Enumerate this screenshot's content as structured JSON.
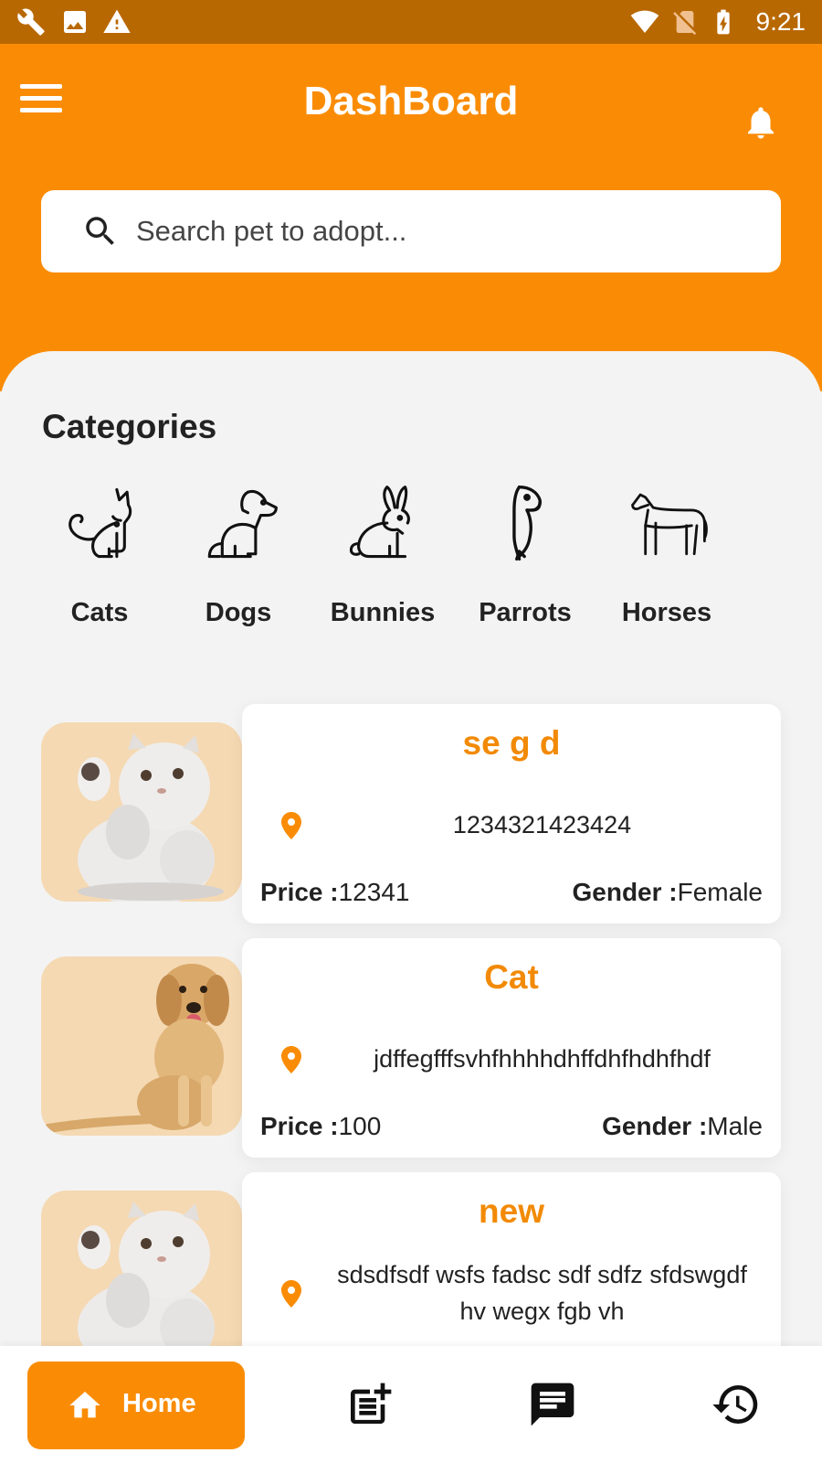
{
  "status_bar": {
    "time": "9:21",
    "icons": [
      "wrench-icon",
      "image-icon",
      "warning-icon",
      "wifi-icon",
      "no-sim-icon",
      "battery-charging-icon"
    ]
  },
  "header": {
    "title": "DashBoard",
    "menu_icon": "hamburger-menu-icon",
    "notification_icon": "bell-icon"
  },
  "search": {
    "placeholder": "Search pet to adopt...",
    "icon": "search-icon"
  },
  "categories": {
    "title": "Categories",
    "items": [
      {
        "label": "Cats",
        "icon": "cat-icon"
      },
      {
        "label": "Dogs",
        "icon": "dog-icon"
      },
      {
        "label": "Bunnies",
        "icon": "bunny-icon"
      },
      {
        "label": "Parrots",
        "icon": "parrot-icon"
      },
      {
        "label": "Horses",
        "icon": "horse-icon"
      }
    ]
  },
  "pets": [
    {
      "name": "se g d",
      "location": "1234321423424",
      "price_label": "Price :",
      "price": "12341",
      "gender_label": "Gender :",
      "gender": "Female",
      "image": "persian-cat-photo"
    },
    {
      "name": "Cat",
      "location": "jdffegfffsvhfhhhhdhffdhfhdhfhdf",
      "price_label": "Price :",
      "price": "100",
      "gender_label": "Gender :",
      "gender": "Male",
      "image": "golden-retriever-photo"
    },
    {
      "name": "new",
      "location_line1": "sdsdfsdf wsfs fadsc sdf sdfz sfdswgdf",
      "location_line2": "hv wegx fgb vh",
      "image": "persian-cat-photo"
    }
  ],
  "bottom_nav": {
    "items": [
      {
        "label": "Home",
        "icon": "home-icon",
        "active": true
      },
      {
        "icon": "add-post-icon"
      },
      {
        "icon": "chat-icon"
      },
      {
        "icon": "history-icon"
      }
    ]
  },
  "colors": {
    "primary": "#fa8c05",
    "status_bar": "#b86800",
    "accent_text": "#f28a06",
    "background": "#f3f3f3"
  }
}
